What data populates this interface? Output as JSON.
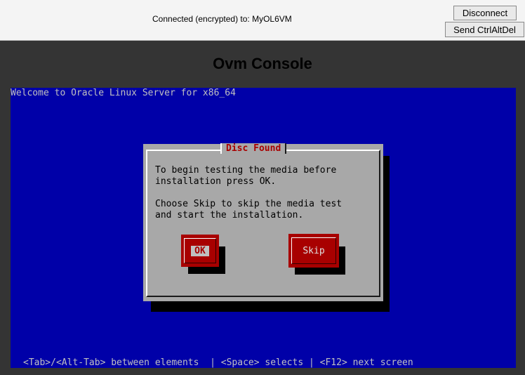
{
  "connection": {
    "status": "Connected (encrypted) to: MyOL6VM",
    "disconnect_label": "Disconnect",
    "send_cad_label": "Send CtrlAltDel"
  },
  "console": {
    "title": "Ovm Console",
    "welcome": "Welcome to Oracle Linux Server for x86_64",
    "hint": "<Tab>/<Alt-Tab> between elements  | <Space> selects | <F12> next screen"
  },
  "dialog": {
    "title": "Disc Found",
    "message": "To begin testing the media before\ninstallation press OK.\n\nChoose Skip to skip the media test\nand start the installation.",
    "ok_label": "OK",
    "skip_label": "Skip"
  },
  "colors": {
    "screen_bg": "#0000a8",
    "dialog_bg": "#a8a8a8",
    "button_bg": "#a80000",
    "title_fg": "#a80000"
  }
}
